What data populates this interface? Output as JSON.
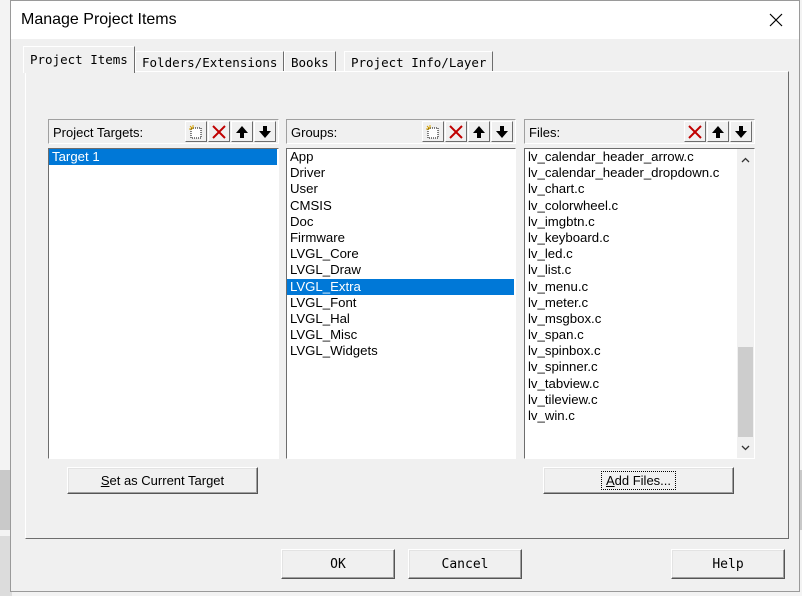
{
  "dialog": {
    "title": "Manage Project Items"
  },
  "tabs": [
    {
      "label": "Project Items",
      "active": true
    },
    {
      "label": "Folders/Extensions",
      "active": false
    },
    {
      "label": "Books",
      "active": false
    },
    {
      "label": "Project Info/Layer",
      "active": false
    }
  ],
  "targets_pane": {
    "title": "Project Targets:",
    "items": [
      "Target 1"
    ],
    "selected": 0,
    "tools": [
      "new-icon",
      "delete-icon",
      "move-up-icon",
      "move-down-icon"
    ]
  },
  "groups_pane": {
    "title": "Groups:",
    "items": [
      "App",
      "Driver",
      "User",
      "CMSIS",
      "Doc",
      "Firmware",
      "LVGL_Core",
      "LVGL_Draw",
      "LVGL_Extra",
      "LVGL_Font",
      "LVGL_Hal",
      "LVGL_Misc",
      "LVGL_Widgets"
    ],
    "selected": 8,
    "tools": [
      "new-icon",
      "delete-icon",
      "move-up-icon",
      "move-down-icon"
    ]
  },
  "files_pane": {
    "title": "Files:",
    "items": [
      "lv_calendar_header_arrow.c",
      "lv_calendar_header_dropdown.c",
      "lv_chart.c",
      "lv_colorwheel.c",
      "lv_imgbtn.c",
      "lv_keyboard.c",
      "lv_led.c",
      "lv_list.c",
      "lv_menu.c",
      "lv_meter.c",
      "lv_msgbox.c",
      "lv_span.c",
      "lv_spinbox.c",
      "lv_spinner.c",
      "lv_tabview.c",
      "lv_tileview.c",
      "lv_win.c"
    ],
    "tools": [
      "delete-icon",
      "move-up-icon",
      "move-down-icon"
    ]
  },
  "buttons": {
    "set_target": {
      "accel": "S",
      "rest": "et as Current Target"
    },
    "add_files": {
      "accel": "A",
      "rest": "dd Files..."
    },
    "ok": "OK",
    "cancel": "Cancel",
    "help": "Help"
  },
  "colors": {
    "selection": "#0078d7",
    "delete_icon": "#c00000",
    "dialog_bg": "#f0f0f0"
  }
}
